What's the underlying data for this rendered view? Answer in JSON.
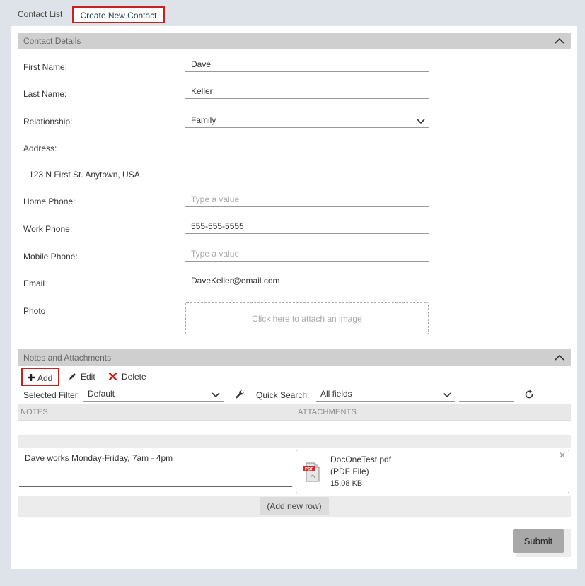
{
  "tabs": {
    "list": "Contact List",
    "create": "Create New Contact"
  },
  "contact_details": {
    "header": "Contact Details",
    "first_name": {
      "label": "First Name:",
      "value": "Dave"
    },
    "last_name": {
      "label": "Last Name:",
      "value": "Keller"
    },
    "relationship": {
      "label": "Relationship:",
      "value": "Family"
    },
    "address": {
      "label": "Address:",
      "value": "123 N First St. Anytown, USA"
    },
    "home_phone": {
      "label": "Home Phone:",
      "placeholder": "Type a value"
    },
    "work_phone": {
      "label": "Work Phone:",
      "value": "555-555-5555"
    },
    "mobile_phone": {
      "label": "Mobile Phone:",
      "placeholder": "Type a value"
    },
    "email": {
      "label": "Email",
      "value": "DaveKeller@email.com"
    },
    "photo": {
      "label": "Photo",
      "dropzone": "Click here to attach an image"
    }
  },
  "notes": {
    "header": "Notes and Attachments",
    "toolbar": {
      "add": "Add",
      "edit": "Edit",
      "delete": "Delete"
    },
    "filter_label": "Selected Filter:",
    "filter_value": "Default",
    "quick_search_label": "Quick Search:",
    "quick_search_field": "All fields",
    "columns": {
      "notes": "NOTES",
      "attachments": "ATTACHMENTS"
    },
    "row": {
      "note": "Dave works Monday-Friday, 7am - 4pm",
      "attachment": {
        "name": "DocOneTest.pdf",
        "type": "(PDF File)",
        "size": "15.08 KB",
        "icon": "pdf-file-icon"
      }
    },
    "add_row": "(Add new row)"
  },
  "submit": "Submit",
  "colors": {
    "highlight": "#cc1f1f",
    "header_bg": "#cfcfcf",
    "page_bg": "#dde3e8"
  }
}
